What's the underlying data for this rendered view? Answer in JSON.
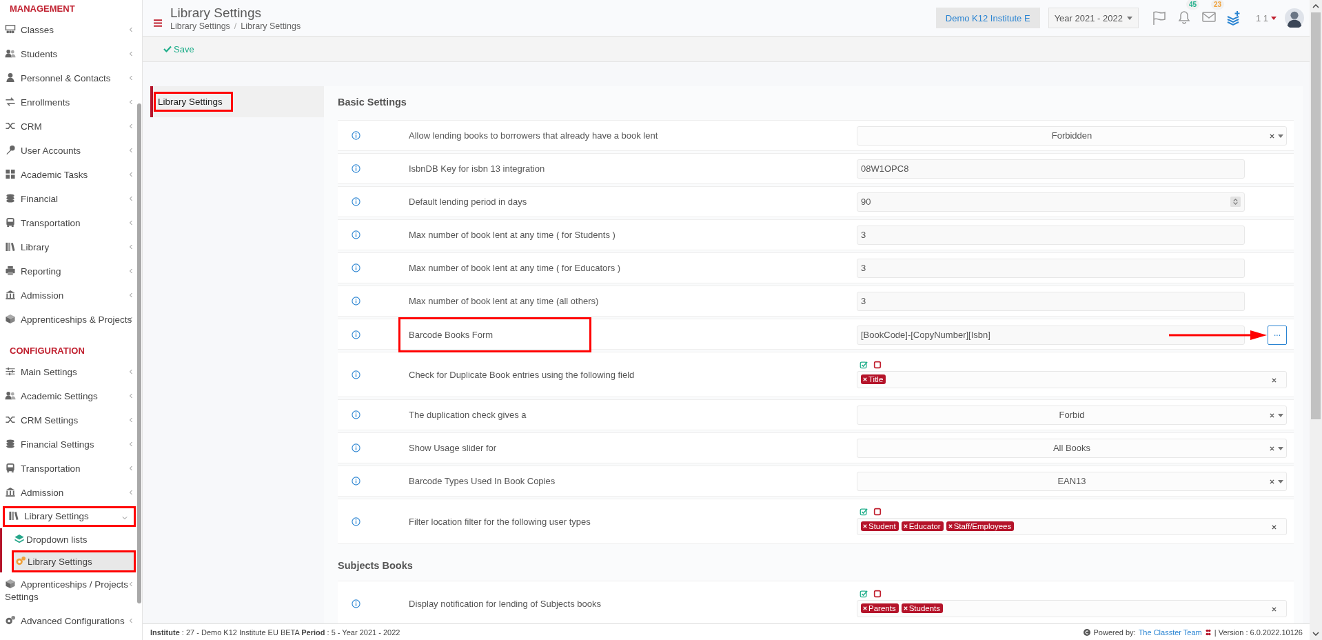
{
  "sidebar": {
    "sections": [
      {
        "title": "MANAGEMENT",
        "items": [
          {
            "label": "Classes",
            "expanded": false,
            "highlighted": false
          },
          {
            "label": "Students",
            "expanded": false,
            "highlighted": false
          },
          {
            "label": "Personnel & Contacts",
            "expanded": false,
            "highlighted": false
          },
          {
            "label": "Enrollments",
            "expanded": false,
            "highlighted": false
          },
          {
            "label": "CRM",
            "expanded": false,
            "highlighted": false
          },
          {
            "label": "User Accounts",
            "expanded": false,
            "highlighted": false
          },
          {
            "label": "Academic Tasks",
            "expanded": false,
            "highlighted": false
          },
          {
            "label": "Financial",
            "expanded": false,
            "highlighted": false
          },
          {
            "label": "Transportation",
            "expanded": false,
            "highlighted": false
          },
          {
            "label": "Library",
            "expanded": false,
            "highlighted": false
          },
          {
            "label": "Reporting",
            "expanded": false,
            "highlighted": false
          },
          {
            "label": "Admission",
            "expanded": false,
            "highlighted": false
          },
          {
            "label": "Apprenticeships & Projects",
            "expanded": false,
            "highlighted": false
          }
        ]
      },
      {
        "title": "CONFIGURATION",
        "items": [
          {
            "label": "Main Settings",
            "expanded": false,
            "highlighted": false
          },
          {
            "label": "Academic Settings",
            "expanded": false,
            "highlighted": false
          },
          {
            "label": "CRM Settings",
            "expanded": false,
            "highlighted": false
          },
          {
            "label": "Financial Settings",
            "expanded": false,
            "highlighted": false
          },
          {
            "label": "Transportation",
            "expanded": false,
            "highlighted": false
          },
          {
            "label": "Admission",
            "expanded": false,
            "highlighted": false
          },
          {
            "label": "Library Settings",
            "expanded": true,
            "highlighted": true,
            "children": [
              {
                "label": "Dropdown lists",
                "selected": false,
                "highlighted": false
              },
              {
                "label": "Library Settings",
                "selected": true,
                "highlighted": true
              }
            ]
          },
          {
            "label": "Apprenticeships / Projects Settings",
            "expanded": false,
            "highlighted": false
          },
          {
            "label": "Advanced Configurations",
            "expanded": false,
            "highlighted": false
          }
        ]
      }
    ]
  },
  "header": {
    "title": "Library Settings",
    "breadcrumb": [
      "Library Settings",
      "Library Settings"
    ],
    "separator": "/",
    "institute": "Demo K12 Institute E",
    "year": "Year 2021 - 2022",
    "badges": [
      {
        "count": "45",
        "color": "#1fae8a"
      },
      {
        "count": "23",
        "color": "#f0a23c"
      }
    ],
    "user": "1 1"
  },
  "toolbar": {
    "save": "Save"
  },
  "settings_nav": [
    {
      "label": "Library Settings",
      "selected": true,
      "highlighted": true
    }
  ],
  "groups": [
    {
      "title": "Basic Settings",
      "rows": [
        {
          "kind": "select",
          "label": "Allow lending books to borrowers that already have a book lent",
          "value": "Forbidden",
          "highlighted": false
        },
        {
          "kind": "text",
          "label": "IsbnDB Key for isbn 13 integration",
          "value": "08W1OPC8",
          "highlighted": false
        },
        {
          "kind": "number",
          "label": "Default lending period in days",
          "value": "90",
          "highlighted": false
        },
        {
          "kind": "text",
          "label": "Max number of book lent at any time ( for Students )",
          "value": "3",
          "highlighted": false
        },
        {
          "kind": "text",
          "label": "Max number of book lent at any time ( for Educators )",
          "value": "3",
          "highlighted": false
        },
        {
          "kind": "text",
          "label": "Max number of book lent at any time (all others)",
          "value": "3",
          "highlighted": false
        },
        {
          "kind": "pattern",
          "label": "Barcode Books Form",
          "value": "[BookCode]-[CopyNumber][Isbn]",
          "button": "...",
          "highlighted": true,
          "arrow": true
        },
        {
          "kind": "tags",
          "label": "Check for Duplicate Book entries using the following field",
          "tags": [
            "Title"
          ],
          "highlighted": false
        },
        {
          "kind": "select",
          "label": "The duplication check gives a",
          "value": "Forbid",
          "highlighted": false
        },
        {
          "kind": "select",
          "label": "Show Usage slider for",
          "value": "All Books",
          "highlighted": false
        },
        {
          "kind": "select",
          "label": "Barcode Types Used In Book Copies",
          "value": "EAN13",
          "highlighted": false
        },
        {
          "kind": "tags",
          "label": "Filter location filter for the following user types",
          "tags": [
            "Student",
            "Educator",
            "Staff/Employees"
          ],
          "highlighted": false
        }
      ]
    },
    {
      "title": "Subjects Books",
      "rows": [
        {
          "kind": "tags",
          "label": "Display notification for lending of Subjects books",
          "tags": [
            "Parents",
            "Students"
          ],
          "highlighted": false
        }
      ]
    }
  ],
  "footer": {
    "info": "**Institute** : 27 - Demo K12 Institute EU BETA **Period** : 5 - Year 2021 - 2022",
    "powered": "Powered by:",
    "link": "The Classter Team",
    "version": "| Version : 6.0.2022.10126"
  }
}
